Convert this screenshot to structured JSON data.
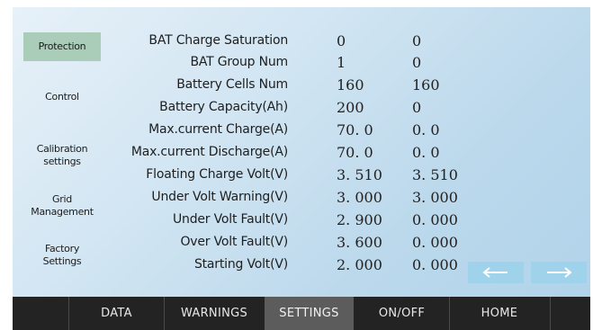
{
  "sidebar": {
    "items": [
      {
        "label": "Protection"
      },
      {
        "label": "Control"
      },
      {
        "label": "Calibration\nsettings"
      },
      {
        "label": "Grid\nManagement"
      },
      {
        "label": "Factory\nSettings"
      }
    ],
    "active_index": 0
  },
  "params": [
    {
      "label": "BAT Charge Saturation",
      "v1": "0",
      "v2": "0"
    },
    {
      "label": "BAT Group Num",
      "v1": "1",
      "v2": "0"
    },
    {
      "label": "Battery Cells Num",
      "v1": "160",
      "v2": "160"
    },
    {
      "label": "Battery Capacity(Ah)",
      "v1": "200",
      "v2": "0"
    },
    {
      "label": "Max.current Charge(A)",
      "v1": "70. 0",
      "v2": "0. 0"
    },
    {
      "label": "Max.current Discharge(A)",
      "v1": "70. 0",
      "v2": "0. 0"
    },
    {
      "label": "Floating Charge Volt(V)",
      "v1": "3. 510",
      "v2": "3. 510"
    },
    {
      "label": "Under Volt Warning(V)",
      "v1": "3. 000",
      "v2": "3. 000"
    },
    {
      "label": "Under Volt Fault(V)",
      "v1": "2. 900",
      "v2": "0. 000"
    },
    {
      "label": "Over Volt Fault(V)",
      "v1": "3. 600",
      "v2": "0. 000"
    },
    {
      "label": "Starting Volt(V)",
      "v1": "2. 000",
      "v2": "0. 000"
    }
  ],
  "nav": {
    "prev_icon": "arrow-left-icon",
    "next_icon": "arrow-right-icon"
  },
  "tabs": [
    {
      "label": "DATA"
    },
    {
      "label": "WARNINGS"
    },
    {
      "label": "SETTINGS"
    },
    {
      "label": "ON/OFF"
    },
    {
      "label": "HOME"
    }
  ],
  "active_tab": 2,
  "colors": {
    "sidebar_active": "#a9cdb9",
    "arrow_button": "#9fd3ec",
    "tabbar": "#232323",
    "tab_active": "#5c5c5c"
  }
}
